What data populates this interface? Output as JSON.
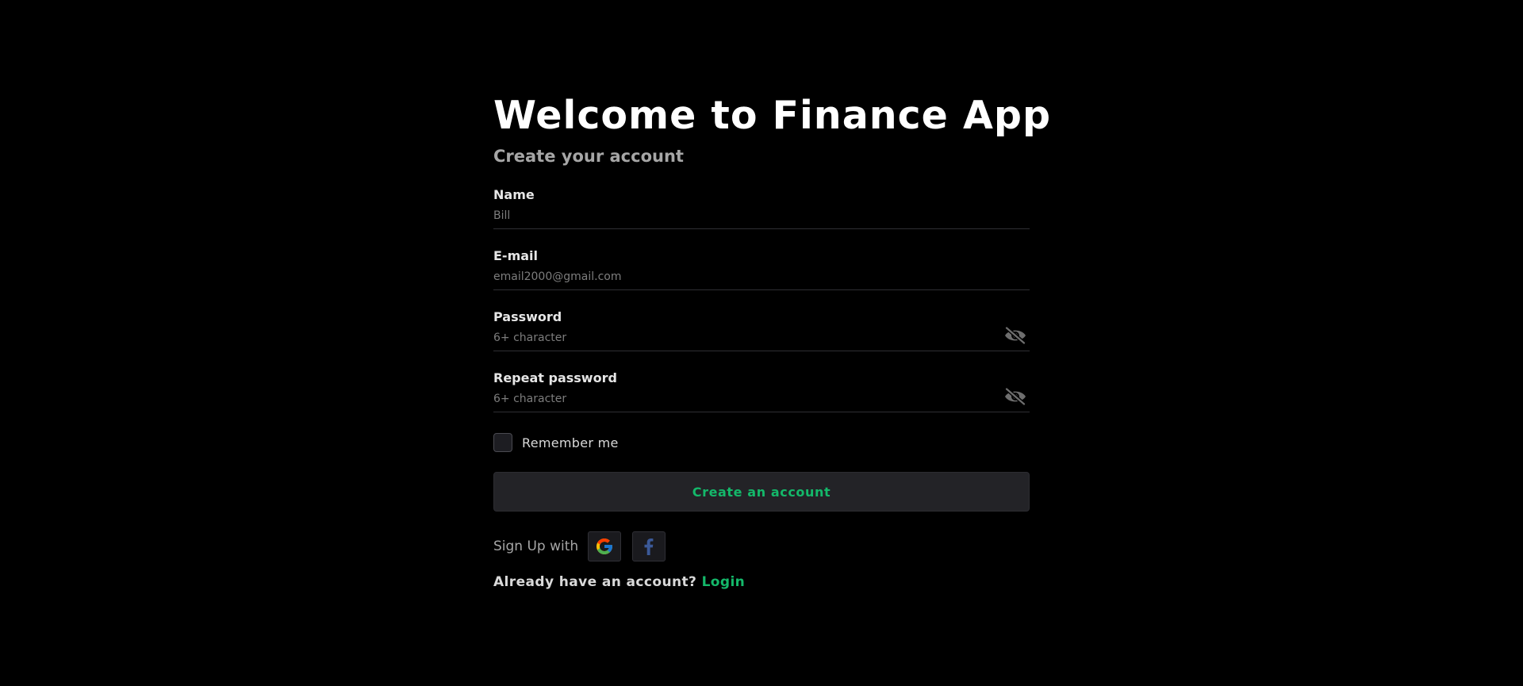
{
  "header": {
    "title": "Welcome to Finance App",
    "subtitle": "Create your account"
  },
  "form": {
    "fields": [
      {
        "label": "Name",
        "placeholder": "Bill",
        "value": ""
      },
      {
        "label": "E-mail",
        "placeholder": "email2000@gmail.com",
        "value": ""
      },
      {
        "label": "Password",
        "placeholder": "6+ character",
        "value": "",
        "icon": "eye-slash-icon"
      },
      {
        "label": "Repeat password",
        "placeholder": "6+ character",
        "value": "",
        "icon": "eye-slash-icon"
      }
    ],
    "remember_label": "Remember me",
    "remember_checked": false,
    "submit_label": "Create an account"
  },
  "social": {
    "label": "Sign Up with",
    "providers": [
      {
        "name": "Google",
        "icon": "google-icon"
      },
      {
        "name": "Facebook",
        "icon": "facebook-icon"
      }
    ]
  },
  "footer": {
    "prompt": "Already have an account?",
    "link": "Login"
  },
  "colors": {
    "background": "#000000",
    "accent": "#14b86a",
    "button_bg": "#232327",
    "muted_text": "#a6a6a6",
    "google_red": "#EA4335",
    "google_yellow": "#FBBC05",
    "google_green": "#34A853",
    "google_blue": "#4285F4",
    "facebook_blue": "#3b5998"
  }
}
